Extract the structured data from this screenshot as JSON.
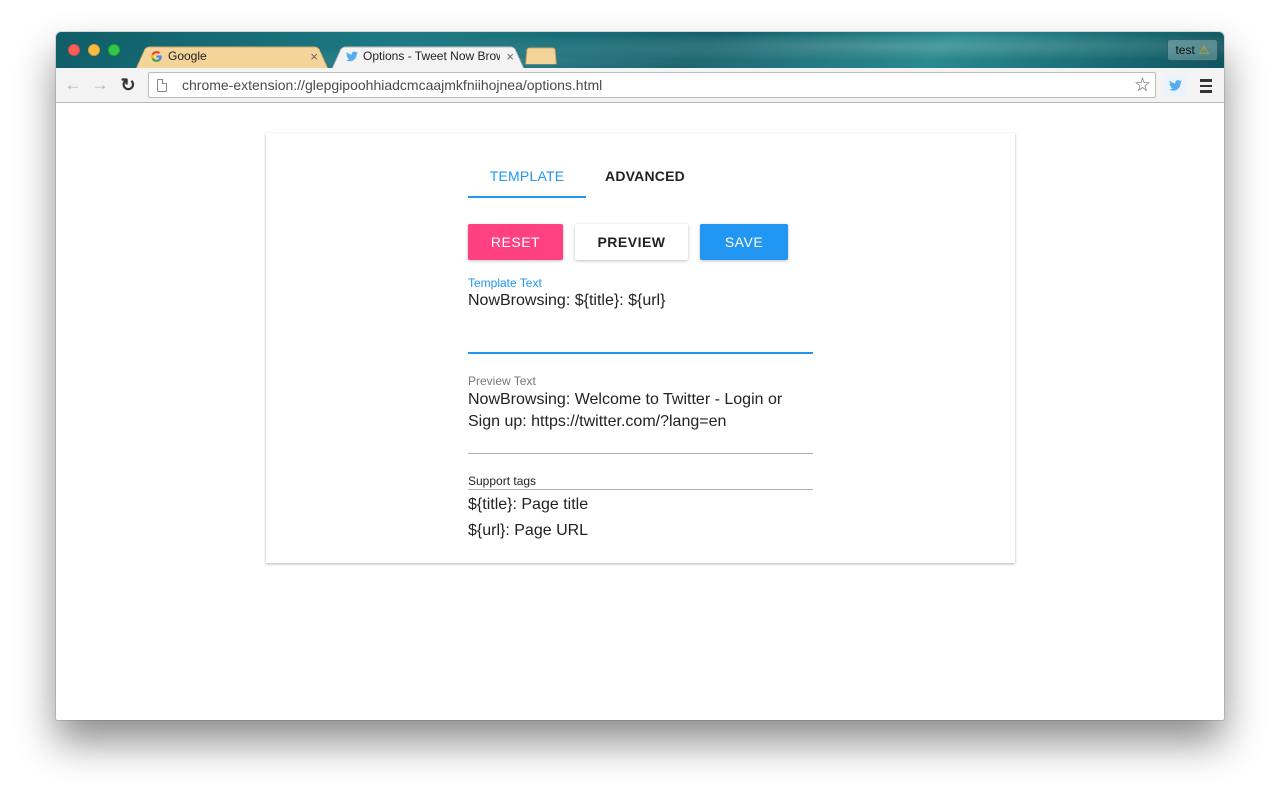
{
  "browser": {
    "tabs": [
      {
        "title": "Google",
        "close": "×",
        "favicon": "google-g-icon"
      },
      {
        "title": "Options - Tweet Now Browsing",
        "close": "×",
        "favicon": "twitter-bird-icon"
      }
    ],
    "profile": {
      "name": "test",
      "warning_icon": "⚠"
    },
    "address": "chrome-extension://glepgipoohhiadcmcaajmkfniihojnea/options.html",
    "icons": {
      "back": "←",
      "forward": "→",
      "reload": "↻",
      "star": "☆"
    }
  },
  "options": {
    "tabs": [
      {
        "label": "TEMPLATE",
        "selected": true
      },
      {
        "label": "ADVANCED",
        "selected": false
      }
    ],
    "buttons": {
      "reset": "RESET",
      "preview": "PREVIEW",
      "save": "SAVE"
    },
    "template_field": {
      "label": "Template Text",
      "value": "NowBrowsing: ${title}: ${url}"
    },
    "preview_field": {
      "label": "Preview Text",
      "value": "NowBrowsing: Welcome to Twitter - Login or Sign up: https://twitter.com/?lang=en"
    },
    "support": {
      "label": "Support tags",
      "lines": [
        "${title}: Page title",
        "${url}: Page URL"
      ]
    }
  },
  "colors": {
    "accent": "#2196f3",
    "reset": "#ff4081",
    "titlebar": "#135f6a"
  }
}
